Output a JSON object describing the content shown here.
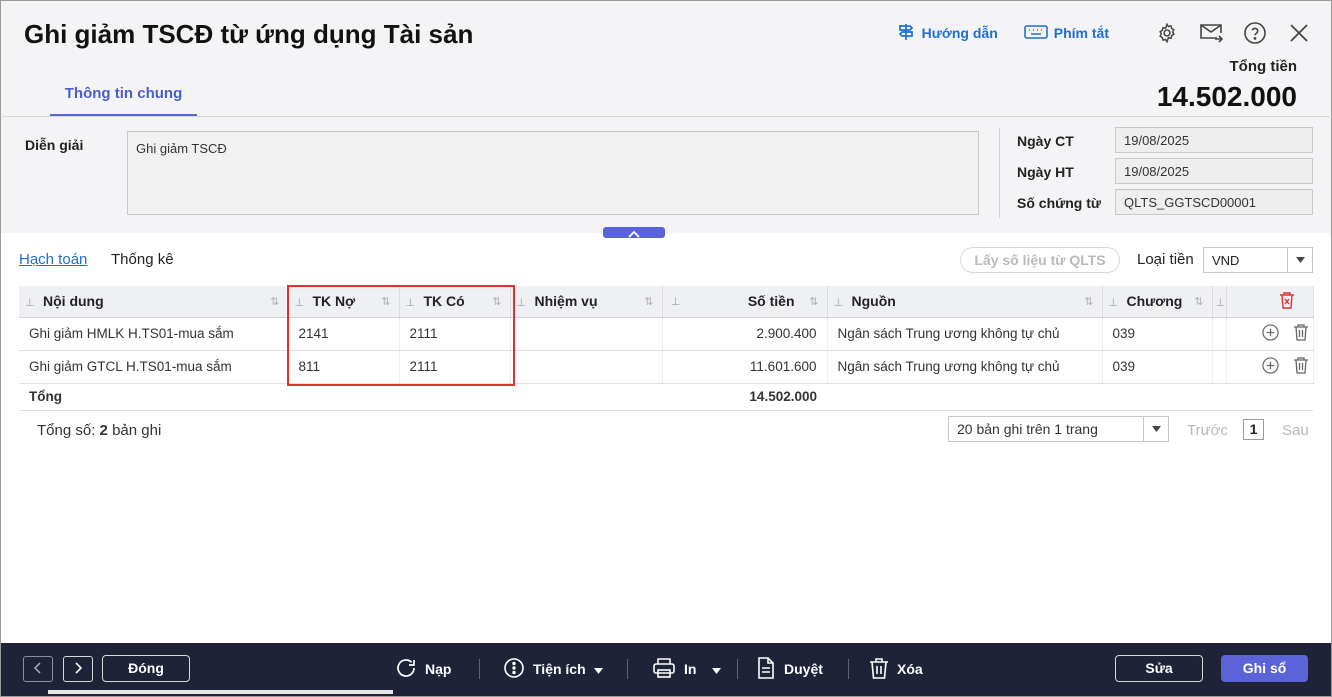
{
  "window": {
    "title": "Ghi giảm TSCĐ từ ứng dụng Tài sản",
    "help_link": "Hướng dẫn",
    "shortcut_link": "Phím tắt"
  },
  "summary": {
    "total_label": "Tổng tiền",
    "total_value": "14.502.000"
  },
  "tabs": {
    "general": "Thông tin chung"
  },
  "form": {
    "description_label": "Diễn giải",
    "description_value": "Ghi giảm TSCĐ",
    "date_ct_label": "Ngày CT",
    "date_ct_value": "19/08/2025",
    "date_ht_label": "Ngày HT",
    "date_ht_value": "19/08/2025",
    "voucher_no_label": "Số chứng từ",
    "voucher_no_value": "QLTS_GGTSCD00001"
  },
  "detail": {
    "tab_accounting": "Hạch toán",
    "tab_statistics": "Thống kê",
    "fetch_button": "Lấy số liệu từ QLTS",
    "currency_label": "Loại tiền",
    "currency_value": "VND",
    "columns": {
      "content": "Nội dung",
      "debit": "TK Nợ",
      "credit": "TK Có",
      "task": "Nhiệm vụ",
      "amount": "Số tiền",
      "source": "Nguồn",
      "chapter": "Chương"
    },
    "rows": [
      {
        "content": "Ghi giảm HMLK H.TS01-mua sắm",
        "debit": "2141",
        "credit": "2111",
        "task": "",
        "amount": "2.900.400",
        "source": "Ngân sách Trung ương không tự chủ",
        "chapter": "039"
      },
      {
        "content": "Ghi giảm GTCL H.TS01-mua sắm",
        "debit": "811",
        "credit": "2111",
        "task": "",
        "amount": "11.601.600",
        "source": "Ngân sách Trung ương không tự chủ",
        "chapter": "039"
      }
    ],
    "total_label": "Tổng",
    "total_amount": "14.502.000"
  },
  "pagination": {
    "count_prefix": "Tổng số:",
    "count_value": "2",
    "count_suffix": "bản ghi",
    "page_size": "20 bản ghi trên 1 trang",
    "prev": "Trước",
    "page": "1",
    "next": "Sau"
  },
  "footer": {
    "close": "Đóng",
    "reload": "Nạp",
    "utilities": "Tiện ích",
    "print": "In",
    "approve": "Duyệt",
    "delete": "Xóa",
    "edit": "Sửa",
    "post": "Ghi sổ"
  },
  "colors": {
    "accent": "#5b63d8",
    "link": "#1f6fd1",
    "highlight": "#e03131",
    "footer_bg": "#1e2338"
  }
}
